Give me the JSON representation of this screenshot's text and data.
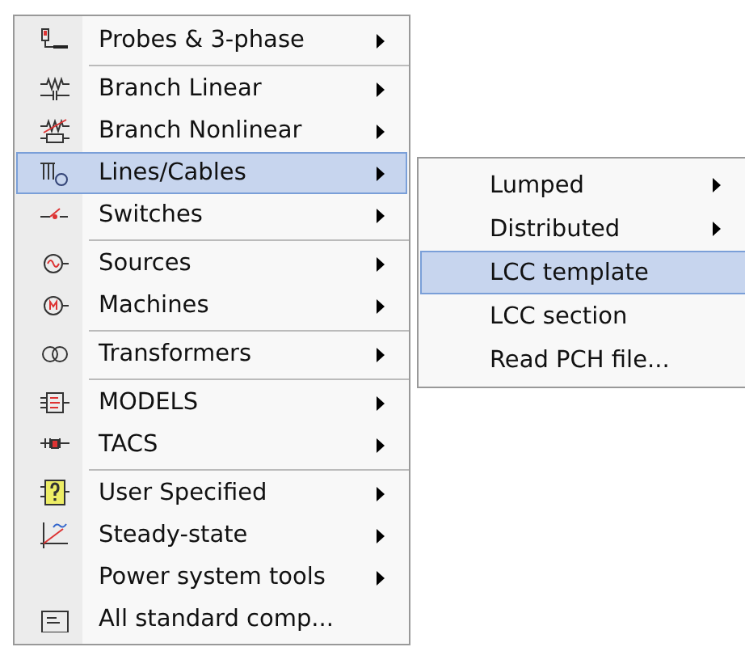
{
  "menu": {
    "items": [
      {
        "kind": "item",
        "label": "Probes & 3-phase",
        "selected": false,
        "submenu": true
      },
      {
        "kind": "separator"
      },
      {
        "kind": "item",
        "label": "Branch Linear",
        "selected": false,
        "submenu": true
      },
      {
        "kind": "item",
        "label": "Branch Nonlinear",
        "selected": false,
        "submenu": true
      },
      {
        "kind": "item",
        "label": "Lines/Cables",
        "selected": true,
        "submenu": true
      },
      {
        "kind": "item",
        "label": "Switches",
        "selected": false,
        "submenu": true
      },
      {
        "kind": "separator"
      },
      {
        "kind": "item",
        "label": "Sources",
        "selected": false,
        "submenu": true
      },
      {
        "kind": "item",
        "label": "Machines",
        "selected": false,
        "submenu": true
      },
      {
        "kind": "separator"
      },
      {
        "kind": "item",
        "label": "Transformers",
        "selected": false,
        "submenu": true
      },
      {
        "kind": "separator"
      },
      {
        "kind": "item",
        "label": "MODELS",
        "selected": false,
        "submenu": true
      },
      {
        "kind": "item",
        "label": "TACS",
        "selected": false,
        "submenu": true
      },
      {
        "kind": "separator"
      },
      {
        "kind": "item",
        "label": "User Specified",
        "selected": false,
        "submenu": true
      },
      {
        "kind": "item",
        "label": "Steady-state",
        "selected": false,
        "submenu": true
      },
      {
        "kind": "item",
        "label": "Power system tools",
        "selected": false,
        "submenu": true
      },
      {
        "kind": "item",
        "label": "All standard comp...",
        "selected": false,
        "submenu": false
      }
    ]
  },
  "submenu": {
    "items": [
      {
        "label": "Lumped",
        "selected": false,
        "submenu": true
      },
      {
        "label": "Distributed",
        "selected": false,
        "submenu": true
      },
      {
        "label": "LCC template",
        "selected": true,
        "submenu": false
      },
      {
        "label": "LCC section",
        "selected": false,
        "submenu": false
      },
      {
        "label": "Read PCH file...",
        "selected": false,
        "submenu": false
      }
    ]
  }
}
